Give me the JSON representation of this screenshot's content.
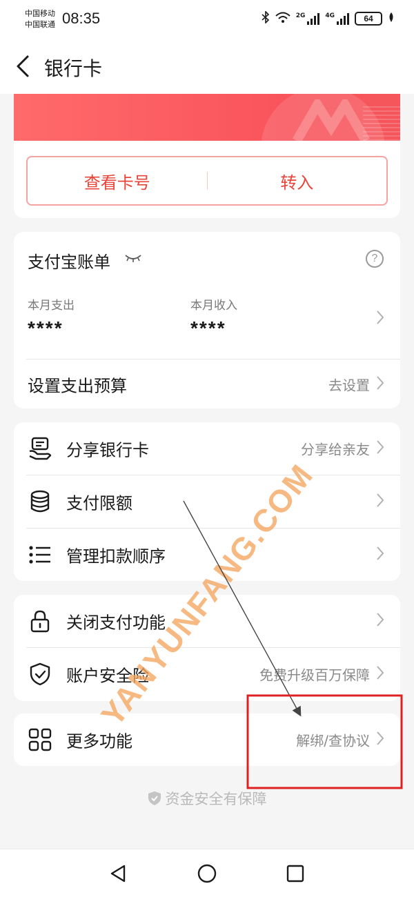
{
  "status_bar": {
    "carrier_1": "中国移动",
    "carrier_2": "中国联通",
    "time": "08:35",
    "network_2g": "2G",
    "network_4g": "4G",
    "battery": "64"
  },
  "header": {
    "title": "银行卡"
  },
  "card_actions": {
    "view_number": "查看卡号",
    "transfer_in": "转入"
  },
  "bill": {
    "title": "支付宝账单",
    "help": "?",
    "expense_label": "本月支出",
    "expense_value": "****",
    "income_label": "本月收入",
    "income_value": "****",
    "budget_label": "设置支出预算",
    "budget_action": "去设置"
  },
  "menu_group_1": [
    {
      "label": "分享银行卡",
      "right": "分享给亲友"
    },
    {
      "label": "支付限额",
      "right": ""
    },
    {
      "label": "管理扣款顺序",
      "right": ""
    }
  ],
  "menu_group_2": [
    {
      "label": "关闭支付功能",
      "right": ""
    },
    {
      "label": "账户安全险",
      "right": "免费升级百万保障"
    }
  ],
  "menu_group_3": [
    {
      "label": "更多功能",
      "right": "解绑/查协议"
    }
  ],
  "footer": {
    "note": "资金安全有保障"
  },
  "watermark": "YANYUNFANG.COM",
  "colors": {
    "accent": "#e8443a",
    "banner": "#f9545c",
    "highlight_box": "#e02020"
  }
}
